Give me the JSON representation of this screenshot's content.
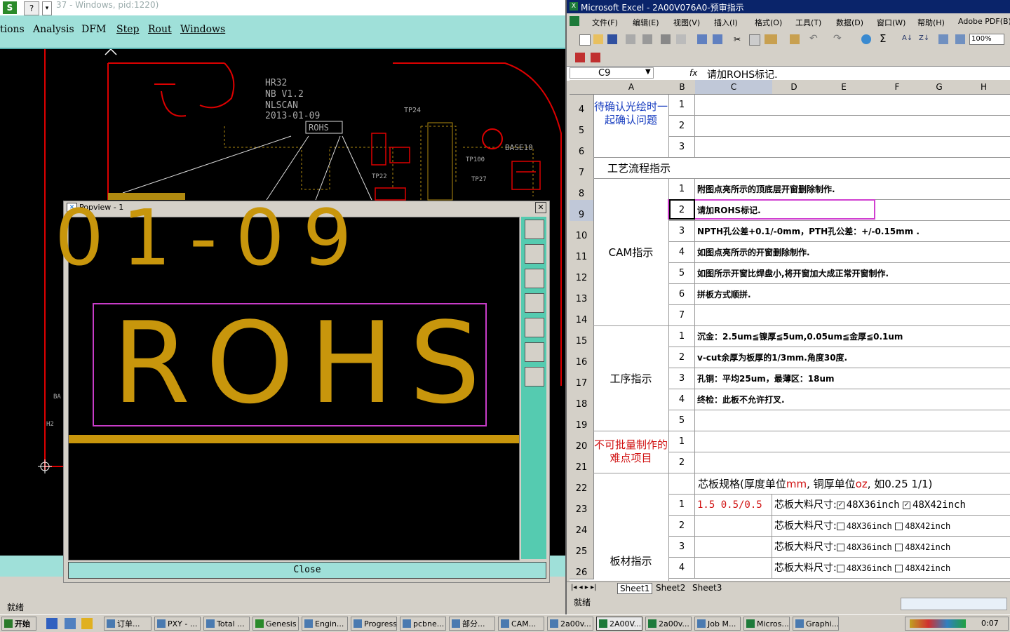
{
  "genesis": {
    "title": "37 - Windows, pid:1220)",
    "menu": [
      "tions",
      "Analysis",
      "DFM",
      "Step",
      "Rout",
      "Windows"
    ],
    "pcb_labels": [
      "HR32",
      "NB V1.2",
      "NLSCAN",
      "2013-01-09",
      "ROHS",
      "TP24",
      "BASE10",
      "TP22",
      "TP27",
      "TP100",
      "H2",
      "BA"
    ],
    "status": "就绪"
  },
  "popview": {
    "title": "Popview - 1",
    "top_text": "01-09",
    "main_text": "ROHS",
    "close_label": "Close"
  },
  "excel": {
    "title": "Microsoft Excel - 2A00V076A0-预审指示",
    "menu": [
      "文件(F)",
      "编辑(E)",
      "视图(V)",
      "插入(I)",
      "格式(O)",
      "工具(T)",
      "数据(D)",
      "窗口(W)",
      "帮助(H)",
      "Adobe PDF(B)"
    ],
    "zoom": "100%",
    "name_box": "C9",
    "fx_label": "fx",
    "formula": "请加ROHS标记.",
    "columns": [
      "A",
      "B",
      "C",
      "D",
      "E",
      "F",
      "G",
      "H"
    ],
    "rows": [
      "4",
      "5",
      "6",
      "7",
      "8",
      "9",
      "10",
      "11",
      "12",
      "13",
      "14",
      "15",
      "16",
      "17",
      "18",
      "19",
      "20",
      "21",
      "22",
      "23",
      "24",
      "25",
      "26"
    ],
    "sections": {
      "confirm": "待确认光绘时一起确认问题",
      "process": "工艺流程指示",
      "cam": "CAM指示",
      "procedure": "工序指示",
      "difficult": "不可批量制作的难点项目",
      "board": "板材指示"
    },
    "cam_items": [
      "附图点亮所示的顶底层开窗删除制作.",
      "请加ROHS标记.",
      "NPTH孔公差+0.1/-0mm，PTH孔公差：+/-0.15mm .",
      "如图点亮所示的开窗删除制作.",
      "如图所示开窗比焊盘小,将开窗加大成正常开窗制作.",
      "拼板方式顺拼.",
      ""
    ],
    "procedure_items": [
      "沉金：2.5um≦镍厚≦5um,0.05um≦金厚≦0.1um",
      "v-cut余厚为板厚的1/3mm.角度30度.",
      "孔铜：平均25um，最薄区：18um",
      "终检：此板不允许打叉.",
      ""
    ],
    "core_spec": {
      "prefix": "芯板规格(厚度单位",
      "unit1": "mm",
      "mid": ", 铜厚单位",
      "unit2": "oz",
      "suffix": ", 如0.25 1/1)",
      "first_value": "1.5 0.5/0.5",
      "size_label": "芯板大料尺寸:",
      "opt1": "48X36inch",
      "opt2": "48X42inch"
    },
    "sheets": [
      "Sheet1",
      "Sheet2",
      "Sheet3"
    ],
    "status": "就绪"
  },
  "taskbar": {
    "start": "开始",
    "items": [
      "订单...",
      "PXY - ...",
      "Total ...",
      "Genesis",
      "Engin...",
      "Progress",
      "pcbne...",
      "部分...",
      "CAM...",
      "2a00v...",
      "2A00V...",
      "2a00v...",
      "Job M...",
      "Micros...",
      "Graphi..."
    ],
    "clock": "0:07"
  }
}
